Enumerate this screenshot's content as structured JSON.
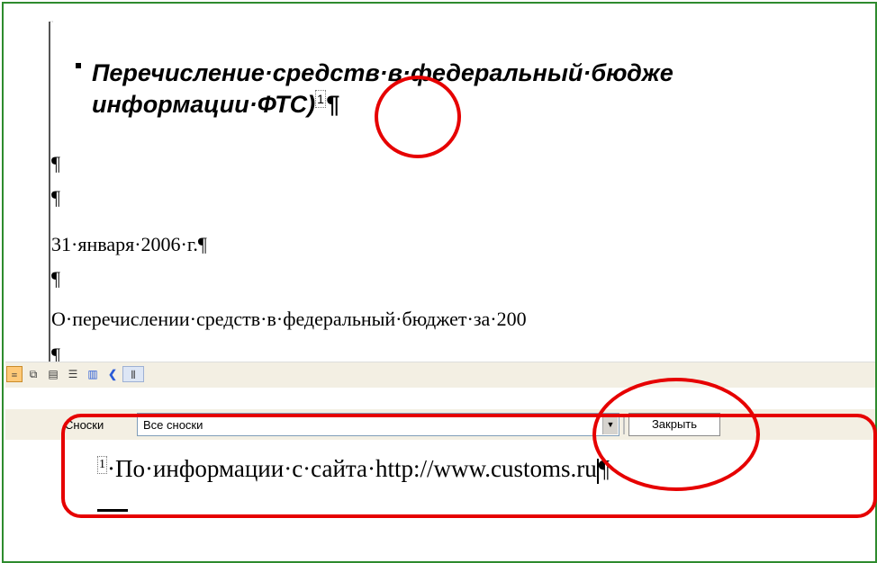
{
  "document": {
    "heading_line1": "Перечисление·средств·в·федеральный·бюдже",
    "heading_line2": "информации·ФТС)",
    "heading_fn_ref": "1",
    "heading_pilcrow": "¶",
    "para_marks": [
      "¶",
      "¶"
    ],
    "date_line": "31·января·2006·г.¶",
    "para_mark_3": "¶",
    "body_line": "О·перечислении·средств·в·федеральный·бюджет·за·200",
    "para_mark_4": "¶"
  },
  "toolbar": {
    "icons": [
      "normal-view-icon",
      "web-layout-icon",
      "print-layout-icon",
      "outline-view-icon",
      "reading-layout-icon",
      "scroll-left-icon",
      "scrollbar-thumb"
    ]
  },
  "footnotes": {
    "label": "Сноски",
    "select_value": "Все сноски",
    "close_label": "Закрыть",
    "note_number": "1",
    "note_text": "·По·информации·с·сайта·http://www.customs.ru",
    "note_pilcrow": "¶"
  },
  "colors": {
    "frame": "#2e8b2e",
    "highlight": "#e60000",
    "pane_bg": "#f3efe3"
  }
}
